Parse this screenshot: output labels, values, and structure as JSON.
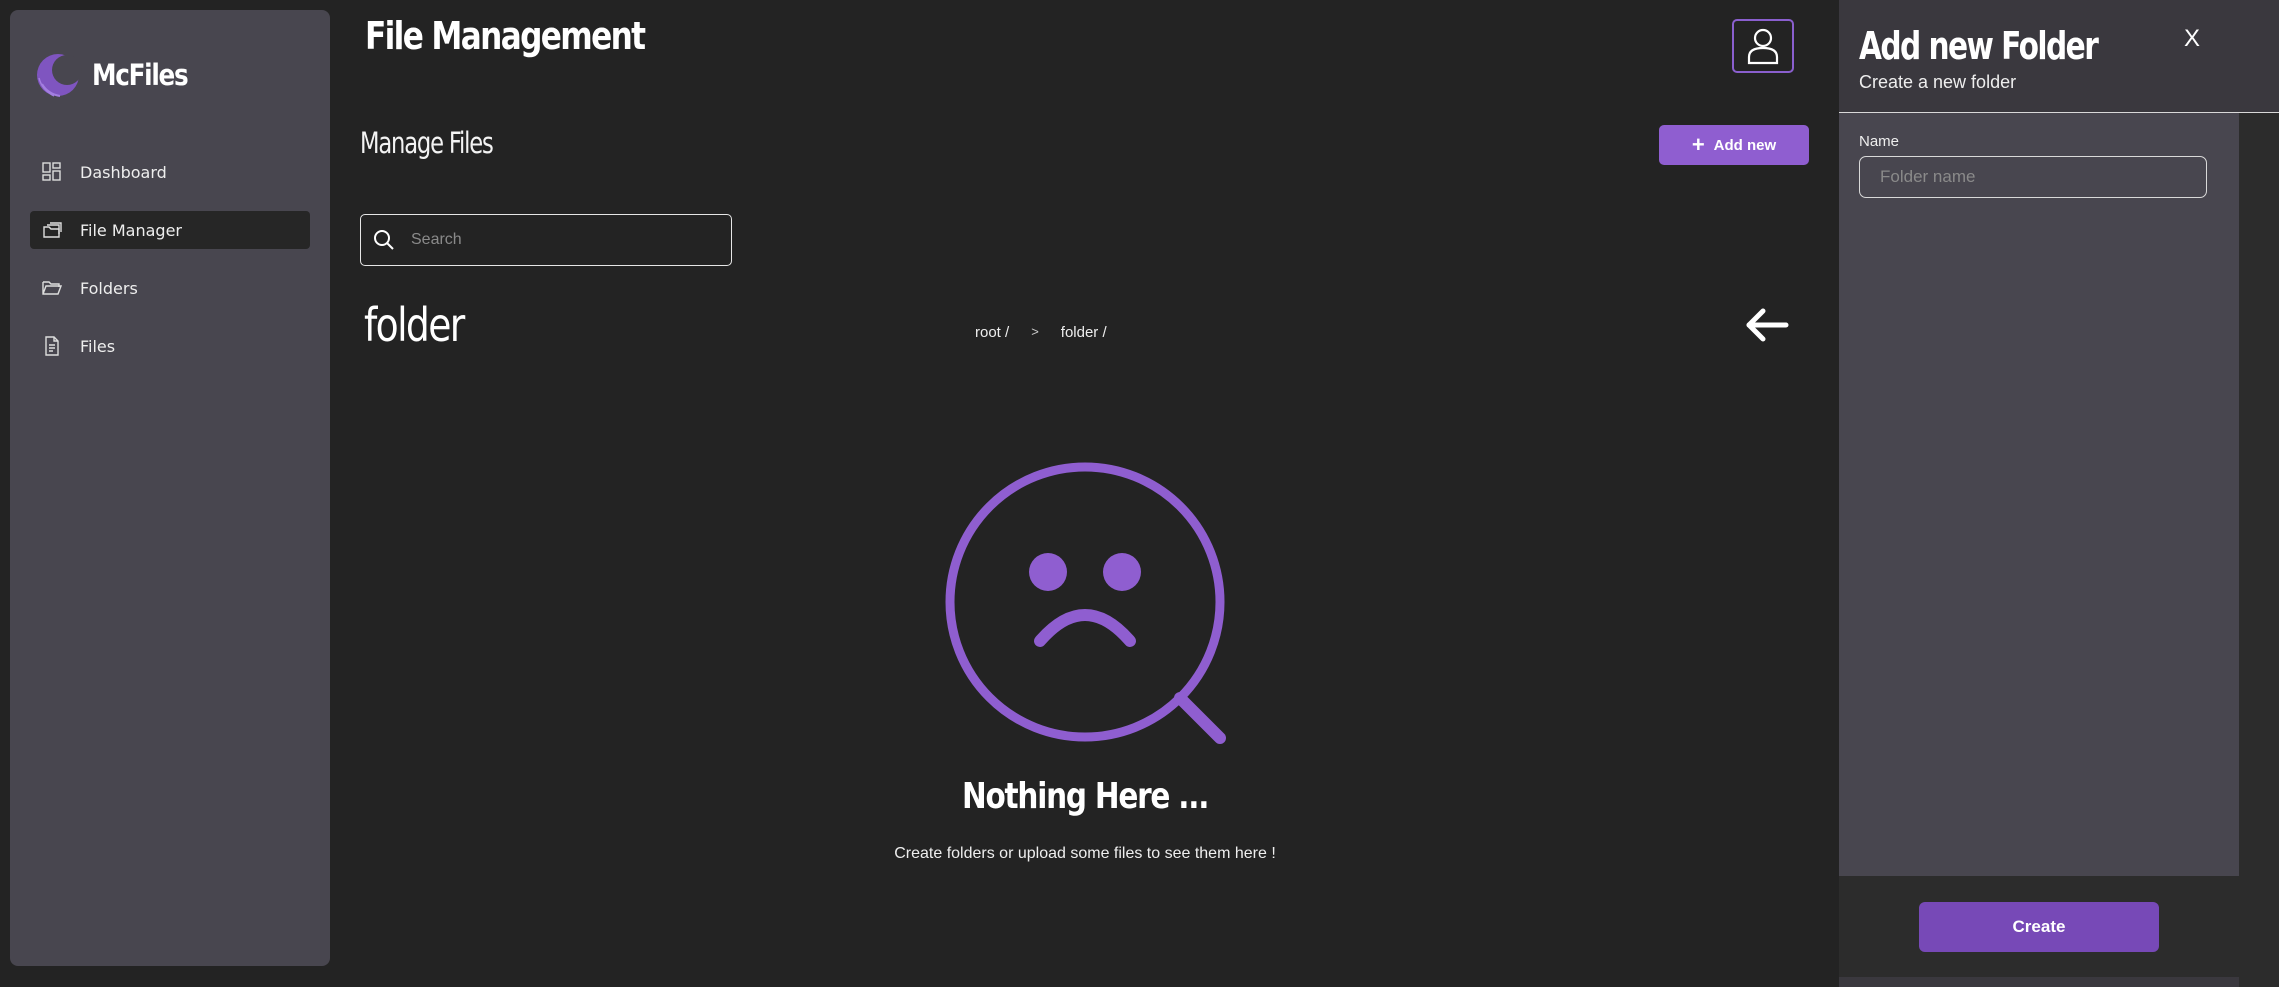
{
  "colors": {
    "accent": "#8f5ed0",
    "button_dark": "#7749b7",
    "sidebar_bg": "#48464f",
    "page_bg": "#232323"
  },
  "app": {
    "name": "McFiles",
    "logo_icon": "crescent-logo-icon"
  },
  "sidebar": {
    "items": [
      {
        "label": "Dashboard",
        "icon": "dashboard-grid-icon",
        "active": false
      },
      {
        "label": "File Manager",
        "icon": "file-manager-icon",
        "active": true
      },
      {
        "label": "Folders",
        "icon": "folder-icon",
        "active": false
      },
      {
        "label": "Files",
        "icon": "file-icon",
        "active": false
      }
    ]
  },
  "header": {
    "title": "File Management",
    "user_icon": "user-icon"
  },
  "main": {
    "subtitle": "Manage Files",
    "add_button": {
      "label": "Add new",
      "icon": "plus-icon"
    },
    "search": {
      "placeholder": "Search",
      "value": "",
      "icon": "search-icon"
    },
    "current_folder": "folder",
    "breadcrumb": {
      "items": [
        "root /",
        "folder /"
      ],
      "separator": ">"
    },
    "back_icon": "arrow-left-icon",
    "empty_state": {
      "icon": "sad-search-icon",
      "title": "Nothing Here ...",
      "message": "Create folders or upload some files to see them here !"
    }
  },
  "panel": {
    "title": "Add new Folder",
    "subtitle": "Create a new folder",
    "close_label": "X",
    "name_label": "Name",
    "name_placeholder": "Folder name",
    "name_value": "",
    "create_label": "Create"
  }
}
